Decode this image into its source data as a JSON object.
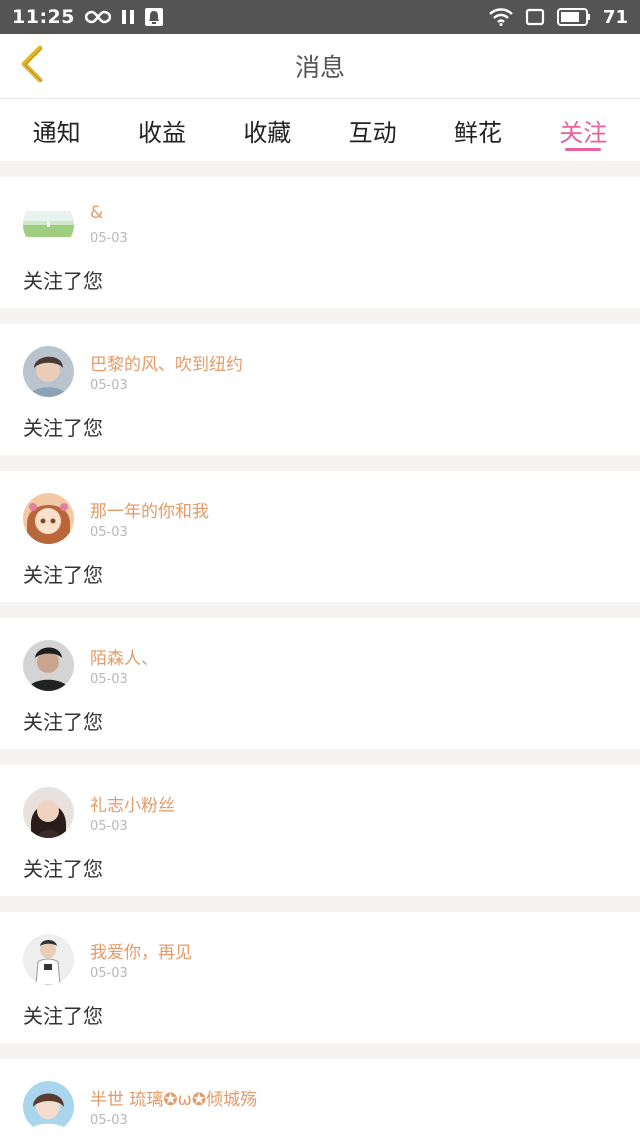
{
  "status_bar": {
    "time": "11:25",
    "battery": "71",
    "icons": [
      "infinity-icon",
      "pause-icon",
      "notification-icon",
      "wifi-icon",
      "screen-icon",
      "battery-icon"
    ]
  },
  "header": {
    "title": "消息",
    "back_icon": "chevron-left-icon"
  },
  "tabs": [
    {
      "label": "通知",
      "active": false
    },
    {
      "label": "收益",
      "active": false
    },
    {
      "label": "收藏",
      "active": false
    },
    {
      "label": "互动",
      "active": false
    },
    {
      "label": "鲜花",
      "active": false
    },
    {
      "label": "关注",
      "active": true
    }
  ],
  "colors": {
    "accent": "#e8609c",
    "name": "#e59b67",
    "back_arrow": "#e3b827",
    "status_bar": "#545454"
  },
  "items": [
    {
      "name": "&",
      "date": "05-03",
      "action": "关注了您"
    },
    {
      "name": "巴黎的风、吹到纽约",
      "date": "05-03",
      "action": "关注了您"
    },
    {
      "name": "那一年的你和我",
      "date": "05-03",
      "action": "关注了您"
    },
    {
      "name": "陌森人、",
      "date": "05-03",
      "action": "关注了您"
    },
    {
      "name": "礼志小粉丝",
      "date": "05-03",
      "action": "关注了您"
    },
    {
      "name": "我爱你，再见",
      "date": "05-03",
      "action": "关注了您"
    },
    {
      "name": "半世 琉璃✪ω✪倾城殇",
      "date": "05-03",
      "action": ""
    }
  ]
}
